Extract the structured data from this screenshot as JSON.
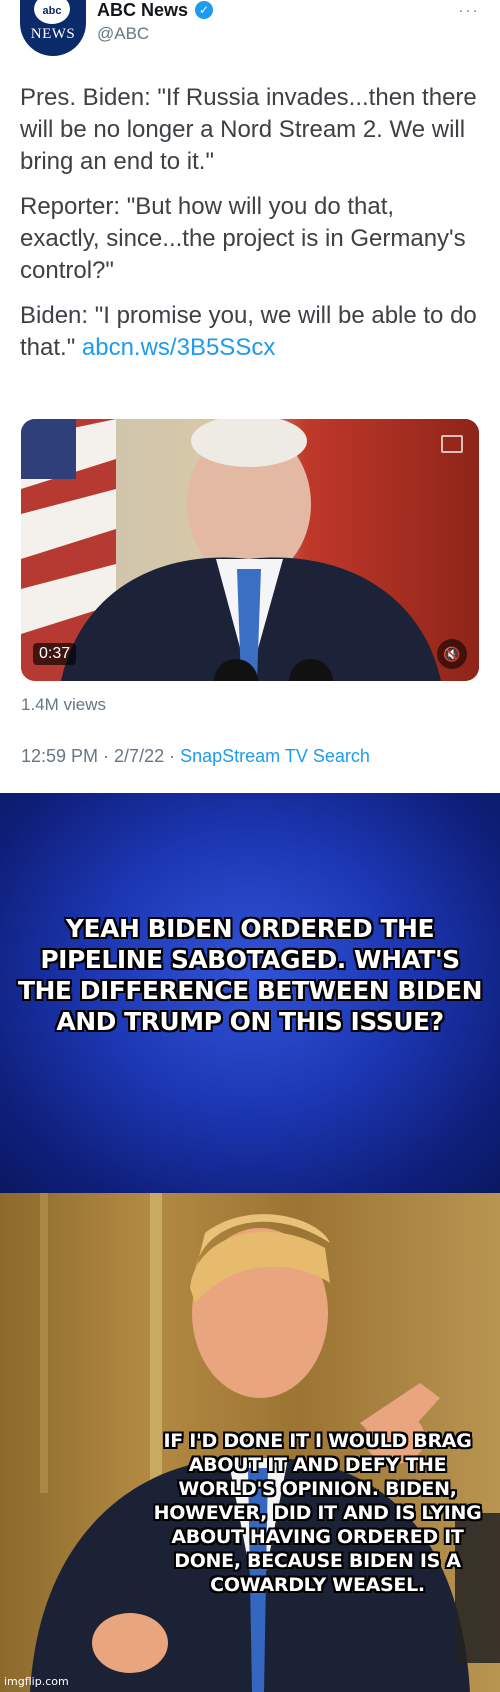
{
  "tweet": {
    "avatar_top": "abc",
    "avatar_bottom": "NEWS",
    "name": "ABC News",
    "handle": "@ABC",
    "more": "···",
    "verified_icon": "✓",
    "text": {
      "p1": "Pres. Biden: \"If Russia invades...then there will be no longer a Nord Stream 2. We will bring an end to it.\"",
      "p2": "Reporter: \"But how will you do that, exactly, since...the project is in Germany's control?\"",
      "p3_prefix": "Biden: \"I promise you, we will be able to do that.\" ",
      "p3_link": "abcn.ws/3B5SScx"
    },
    "video": {
      "duration": "0:37",
      "mute_icon": "speaker-muted-icon"
    },
    "views": "1.4M views",
    "timestamp": "12:59 PM · 2/7/22 · ",
    "source": "SnapStream TV Search"
  },
  "panel1": {
    "caption": "YEAH BIDEN ORDERED THE PIPELINE SABOTAGED.  WHAT'S THE DIFFERENCE BETWEEN BIDEN AND TRUMP ON THIS ISSUE?"
  },
  "panel2": {
    "caption": "IF I'D DONE IT I WOULD BRAG ABOUT IT AND DEFY THE WORLD'S OPINION.  BIDEN, HOWEVER, DID IT AND IS LYING ABOUT HAVING ORDERED IT DONE, BECAUSE BIDEN IS A COWARDLY WEASEL."
  },
  "watermark": "imgflip.com",
  "colors": {
    "link": "#1d9bf0",
    "brand": "#0b2a6a"
  }
}
